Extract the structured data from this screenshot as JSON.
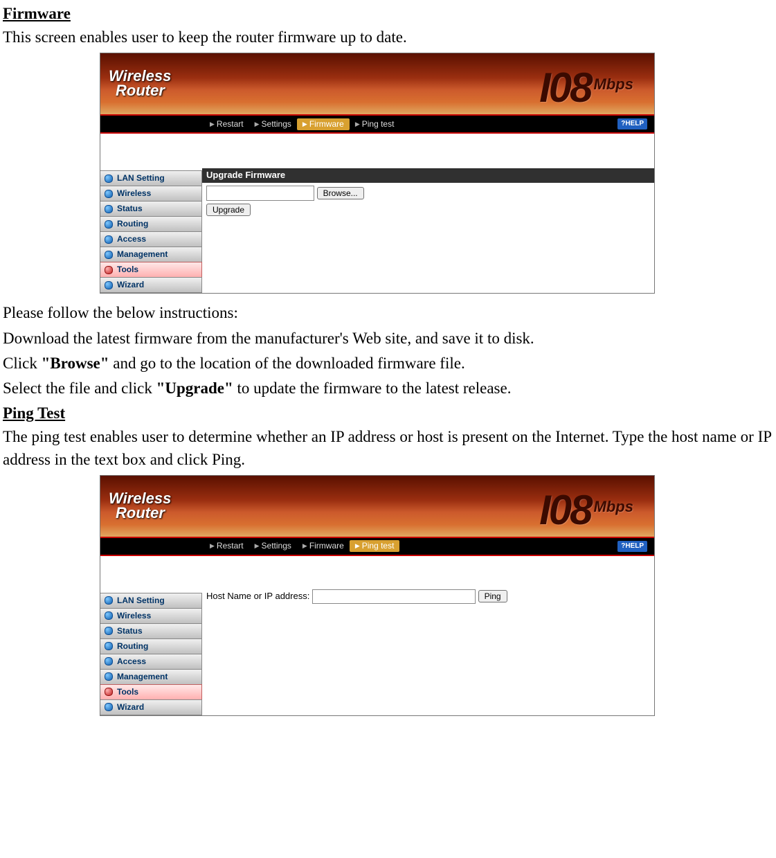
{
  "doc": {
    "firmware_heading": "Firmware",
    "firmware_intro": "This screen enables user to keep the router firmware up to date.",
    "instructions_heading": "Please follow the below instructions:",
    "instruction1": "Download the latest firmware from the manufacturer's Web site, and save it to disk.",
    "instruction2_pre": "Click ",
    "instruction2_bold": "\"Browse\"",
    "instruction2_post": " and go to the location of the downloaded firmware file.",
    "instruction3_pre": "Select the file and click ",
    "instruction3_bold": "\"Upgrade\"",
    "instruction3_post": " to update the firmware to the latest release.",
    "pingtest_heading": "Ping Test",
    "pingtest_intro": "The ping test enables user to determine whether an IP address or host is present on the Internet. Type the host name or IP address in the text box and click Ping."
  },
  "router": {
    "logo_line1": "Wireless",
    "logo_line2": "Router",
    "speed_number": "I08",
    "speed_unit": "Mbps",
    "tabs": {
      "restart": "Restart",
      "settings": "Settings",
      "firmware": "Firmware",
      "pingtest": "Ping test"
    },
    "help": "HELP",
    "sidebar": {
      "lan": "LAN Setting",
      "wireless": "Wireless",
      "status": "Status",
      "routing": "Routing",
      "access": "Access",
      "management": "Management",
      "tools": "Tools",
      "wizard": "Wizard"
    },
    "firmware_panel": {
      "title": "Upgrade Firmware",
      "browse": "Browse...",
      "upgrade": "Upgrade"
    },
    "ping_panel": {
      "label": "Host Name or IP address:",
      "ping": "Ping"
    }
  }
}
